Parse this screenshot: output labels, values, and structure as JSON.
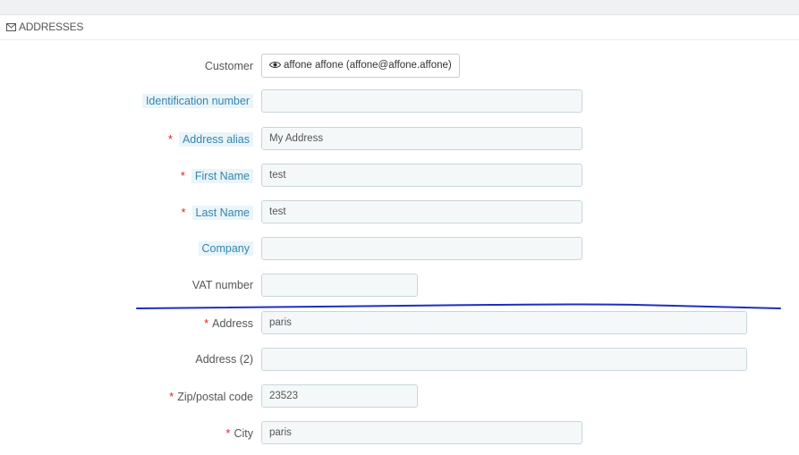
{
  "panel": {
    "title": "ADDRESSES",
    "icon": "envelope-icon"
  },
  "colors": {
    "required": "#e41b23",
    "help_label": "#3586ae",
    "annotation": "#1e2fbd"
  },
  "fields": {
    "customer": {
      "label": "Customer",
      "value": "affone affone (affone@affone.affone)",
      "icon": "eye-icon"
    },
    "identification_number": {
      "label": "Identification number",
      "value": "",
      "required": false
    },
    "address_alias": {
      "label": "Address alias",
      "value": "My Address",
      "required": true
    },
    "first_name": {
      "label": "First Name",
      "value": "test",
      "required": true
    },
    "last_name": {
      "label": "Last Name",
      "value": "test",
      "required": true
    },
    "company": {
      "label": "Company",
      "value": "",
      "required": false
    },
    "vat_number": {
      "label": "VAT number",
      "value": "",
      "required": false
    },
    "address": {
      "label": "Address",
      "value": "paris",
      "required": true
    },
    "address2": {
      "label": "Address (2)",
      "value": "",
      "required": false
    },
    "zip": {
      "label": "Zip/postal code",
      "value": "23523",
      "required": true
    },
    "city": {
      "label": "City",
      "value": "paris",
      "required": true
    }
  },
  "required_mark": "*"
}
